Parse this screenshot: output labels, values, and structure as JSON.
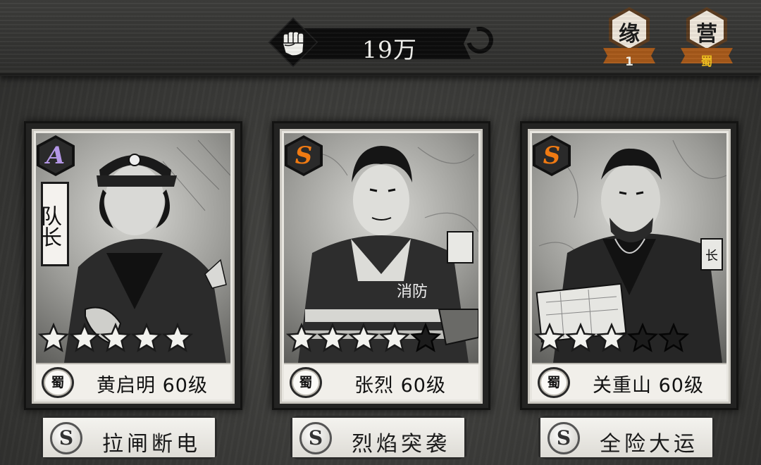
{
  "header": {
    "power_value": "19万",
    "power_icon": "fist-icon",
    "badges": [
      {
        "glyph": "缘",
        "sub": "1",
        "sub_color": "#f3f0e6"
      },
      {
        "glyph": "营",
        "sub": "蜀",
        "sub_color": "#f2c21f"
      }
    ]
  },
  "colors": {
    "rank_s": "#f07a12",
    "rank_a": "#b497e6",
    "badge_ribbon": "#a85a1a"
  },
  "heroes": [
    {
      "rank": "A",
      "captain_label": "队长",
      "stars_filled": 5,
      "stars_total": 5,
      "faction": "蜀",
      "name_level": "黄启明 60级",
      "skill_badge": "S",
      "skill_name": "拉闸断电"
    },
    {
      "rank": "S",
      "jacket_text": "消防",
      "stars_filled": 4,
      "stars_total": 5,
      "faction": "蜀",
      "name_level": "张烈 60级",
      "skill_badge": "S",
      "skill_name": "烈焰突袭"
    },
    {
      "rank": "S",
      "patch_text": "长",
      "stars_filled": 3,
      "stars_total": 5,
      "faction": "蜀",
      "name_level": "关重山 60级",
      "skill_badge": "S",
      "skill_name": "全险大运"
    }
  ]
}
